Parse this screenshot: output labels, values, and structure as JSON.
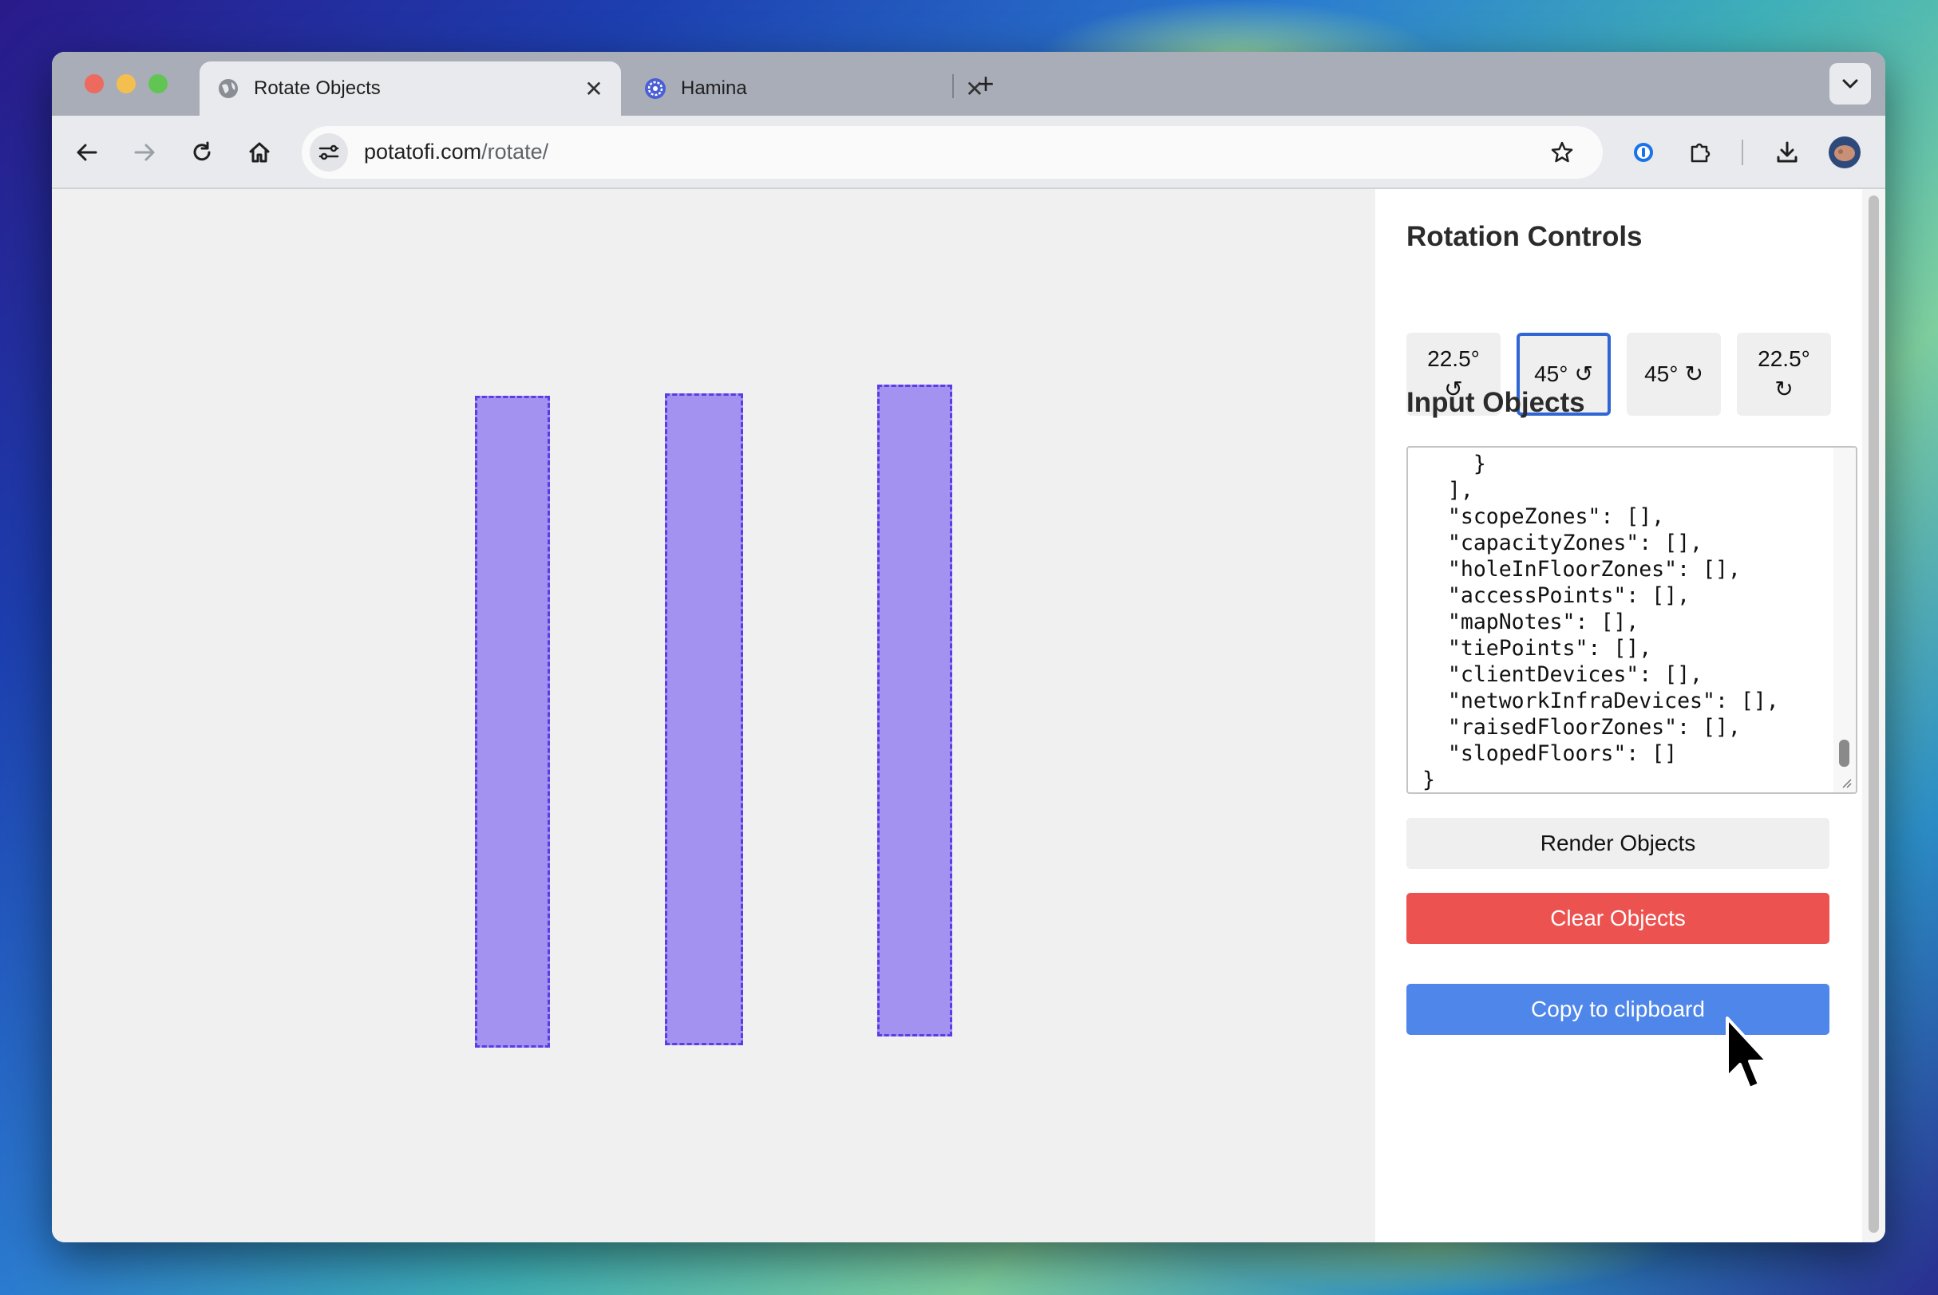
{
  "browser": {
    "tabs": [
      {
        "title": "Rotate Objects",
        "active": true
      },
      {
        "title": "Hamina",
        "active": false
      }
    ],
    "url_host": "potatofi.com",
    "url_path": "/rotate/"
  },
  "panel": {
    "rotation_title": "Rotation Controls",
    "rotation_buttons": [
      {
        "label": "22.5°",
        "icon": "↺"
      },
      {
        "label": "45°",
        "icon": "↺"
      },
      {
        "label": "45°",
        "icon": "↻"
      },
      {
        "label": "22.5°",
        "icon": "↻"
      }
    ],
    "input_title": "Input Objects",
    "textarea_lines": [
      "    }",
      "  ],",
      "  \"scopeZones\": [],",
      "  \"capacityZones\": [],",
      "  \"holeInFloorZones\": [],",
      "  \"accessPoints\": [],",
      "  \"mapNotes\": [],",
      "  \"tiePoints\": [],",
      "  \"clientDevices\": [],",
      "  \"networkInfraDevices\": [],",
      "  \"raisedFloorZones\": [],",
      "  \"slopedFloors\": []",
      "}"
    ],
    "render_label": "Render Objects",
    "clear_label": "Clear Objects",
    "copy_label": "Copy to clipboard"
  },
  "colors": {
    "object_fill": "#a392ef",
    "object_border": "#5b3ce6",
    "clear_button": "#ec5350",
    "copy_button": "#4f86ea",
    "selected_border": "#2f66d4"
  }
}
